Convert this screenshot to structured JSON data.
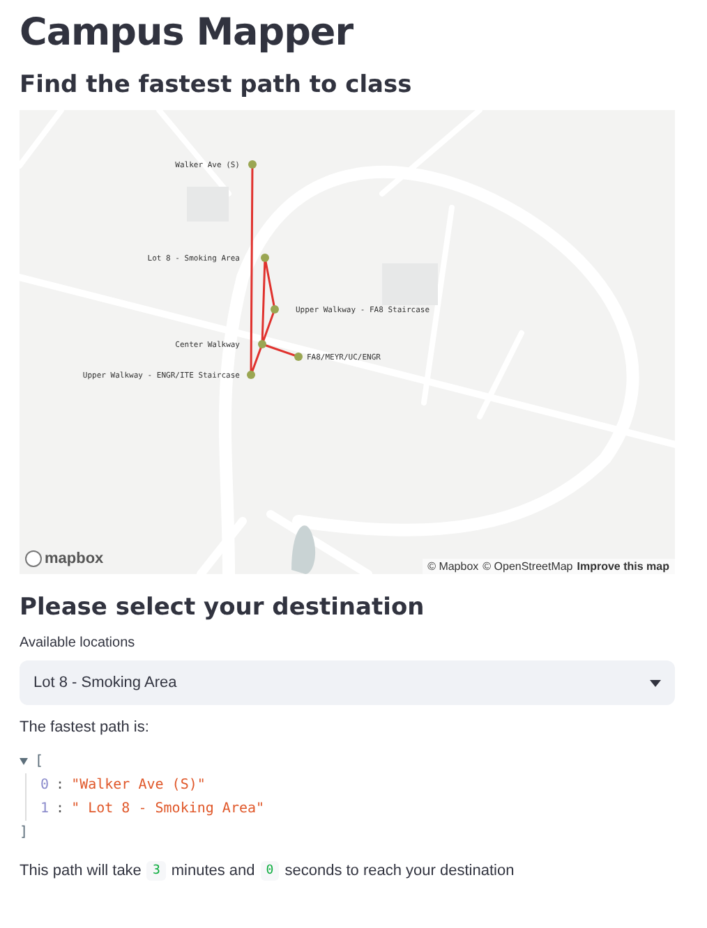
{
  "title": "Campus Mapper",
  "subtitle": "Find the fastest path to class",
  "map": {
    "nodes": [
      {
        "label": "Walker Ave (S)"
      },
      {
        "label": "Lot 8 - Smoking Area"
      },
      {
        "label": "Upper Walkway - FA8 Staircase"
      },
      {
        "label": "Center Walkway"
      },
      {
        "label": "FA8/MEYR/UC/ENGR"
      },
      {
        "label": "Upper Walkway - ENGR/ITE Staircase"
      }
    ],
    "attribution": [
      "© Mapbox",
      "© OpenStreetMap"
    ],
    "improve_link": "Improve this map",
    "logo": "mapbox"
  },
  "section_heading": "Please select your destination",
  "select": {
    "label": "Available locations",
    "value": "Lot 8 - Smoking Area"
  },
  "path_intro": "The fastest path is:",
  "path": {
    "expanded": true,
    "open": "[",
    "close": "]",
    "separator": ":",
    "items": [
      {
        "index": "0",
        "value": "\"Walker Ave (S)\""
      },
      {
        "index": "1",
        "value": "\" Lot 8 - Smoking Area\""
      }
    ]
  },
  "duration": {
    "before": "This path will take",
    "minutes": "3",
    "middle": "minutes and",
    "seconds": "0",
    "after": "seconds to reach your destination"
  }
}
